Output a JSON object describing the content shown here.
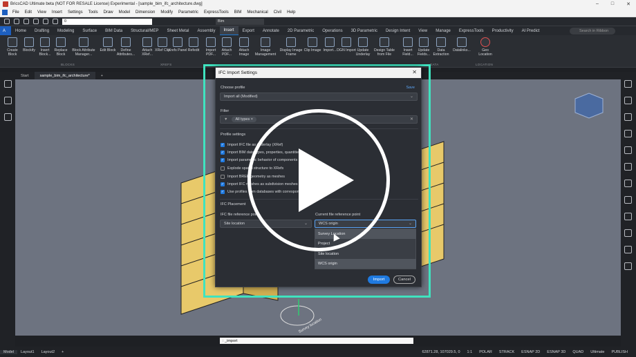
{
  "window": {
    "title": "BricsCAD Ultimate beta (NOT FOR RESALE License) Experimental - [sample_bim_ifc_architecture.dwg]"
  },
  "menu": [
    "File",
    "Edit",
    "View",
    "Insert",
    "Settings",
    "Tools",
    "Draw",
    "Model",
    "Dimension",
    "Modify",
    "Parametric",
    "ExpressTools",
    "BIM",
    "Mechanical",
    "Civil",
    "Help"
  ],
  "quick": {
    "layer_value": "0",
    "workspace_value": "Bim"
  },
  "ribbon_tabs": [
    "Home",
    "Drafting",
    "Modeling",
    "Surface",
    "BIM Data",
    "Structural/MEP",
    "Sheet Metal",
    "Assembly",
    "Insert",
    "Export",
    "Annotate",
    "2D Parametric",
    "Operations",
    "3D Parametric",
    "Design Intent",
    "View",
    "Manage",
    "ExpressTools",
    "Productivity",
    "AI Predict"
  ],
  "active_tab": "Insert",
  "search_placeholder": "Search in Ribbon",
  "ribbon_buttons": [
    {
      "label": "Create Block",
      "icon": "create-block-icon"
    },
    {
      "label": "Blockify",
      "icon": "blockify-icon"
    },
    {
      "label": "Insert Block...",
      "icon": "insert-block-icon"
    },
    {
      "label": "Replace Block",
      "icon": "replace-block-icon"
    },
    {
      "label": "Block Attribute Manager...",
      "icon": "attribute-manager-icon"
    },
    {
      "label": "Edit Block",
      "icon": "edit-block-icon"
    },
    {
      "label": "Define Attributes...",
      "icon": "define-attributes-icon"
    },
    {
      "label": "Attach XRef...",
      "icon": "attach-xref-icon"
    },
    {
      "label": "XRef Clip",
      "icon": "xref-clip-icon"
    },
    {
      "label": "Xrefs Panel",
      "icon": "xrefs-panel-icon"
    },
    {
      "label": "Refedit",
      "icon": "refedit-icon"
    },
    {
      "label": "Import PDF...",
      "icon": "import-pdf-icon"
    },
    {
      "label": "Attach PDF...",
      "icon": "attach-pdf-icon"
    },
    {
      "label": "Attach Image",
      "icon": "attach-image-icon"
    },
    {
      "label": "Image Management",
      "icon": "image-management-icon"
    },
    {
      "label": "Display Image Frame",
      "icon": "image-frame-icon"
    },
    {
      "label": "Clip Image",
      "icon": "clip-image-icon"
    },
    {
      "label": "Import...",
      "icon": "import-icon"
    },
    {
      "label": "DGN Import",
      "icon": "dgn-import-icon"
    },
    {
      "label": "Update Underlay",
      "icon": "update-underlay-icon"
    },
    {
      "label": "Design Table from File",
      "icon": "design-table-icon"
    },
    {
      "label": "Insert Field...",
      "icon": "insert-field-icon"
    },
    {
      "label": "Update Fields...",
      "icon": "update-fields-icon"
    },
    {
      "label": "Data Extraction",
      "icon": "data-extraction-icon"
    },
    {
      "label": "Datalinks...",
      "icon": "datalinks-icon"
    },
    {
      "label": "Geo Location",
      "icon": "geo-location-icon"
    }
  ],
  "ribbon_groups": [
    "BLOCKS",
    "XREFS",
    "DATA",
    "LOCATION"
  ],
  "doc_tabs": [
    "Start",
    "sample_bim_ifc_architecture*",
    "+"
  ],
  "dialog": {
    "title": "IFC Import Settings",
    "choose_profile_label": "Choose profile",
    "save_label": "Save",
    "profile_value": "Import all (Modified)",
    "filter_label": "Filter",
    "filter_chip": "All types",
    "profile_settings_label": "Profile settings",
    "options": [
      {
        "label": "Import IFC file as underlay (XRef)",
        "checked": true
      },
      {
        "label": "Import BIM data types, properties, quantities",
        "checked": true
      },
      {
        "label": "Import parametric behavior of components",
        "checked": true
      },
      {
        "label": "Explode spatial structure to XRefs",
        "checked": false
      },
      {
        "label": "Import BREP geometry as meshes",
        "checked": false
      },
      {
        "label": "Import IFC meshes as subdivision meshes",
        "checked": true
      },
      {
        "label": "Use profiles from databases with correspondence",
        "checked": true
      }
    ],
    "placement_label": "IFC Placement",
    "ifc_ref_label": "IFC file reference point",
    "ifc_ref_value": "Site location",
    "current_ref_label": "Current file reference point",
    "current_ref_value": "WCS origin",
    "dropdown_options": [
      "Survey Location",
      "Project",
      "Site location",
      "WCS origin"
    ],
    "import_label": "Import",
    "cancel_label": "Cancel"
  },
  "viewport": {
    "survey_label": "Survey location"
  },
  "command_line": ": _import",
  "layout_tabs": [
    "Model",
    "Layout1",
    "Layout2",
    "+"
  ],
  "status": {
    "coords": "62871.28, 107029.5, 0",
    "scale": "1:1",
    "toggles": [
      "POLAR",
      "STRACK",
      "ESNAP 2D",
      "ESNAP 3D",
      "QUAD"
    ],
    "workspace": "Ultimate",
    "publish": "PUBLISH"
  },
  "colors": {
    "accent": "#1f7ae0",
    "highlight": "#3fe3bf",
    "building": "#e8c96a"
  }
}
